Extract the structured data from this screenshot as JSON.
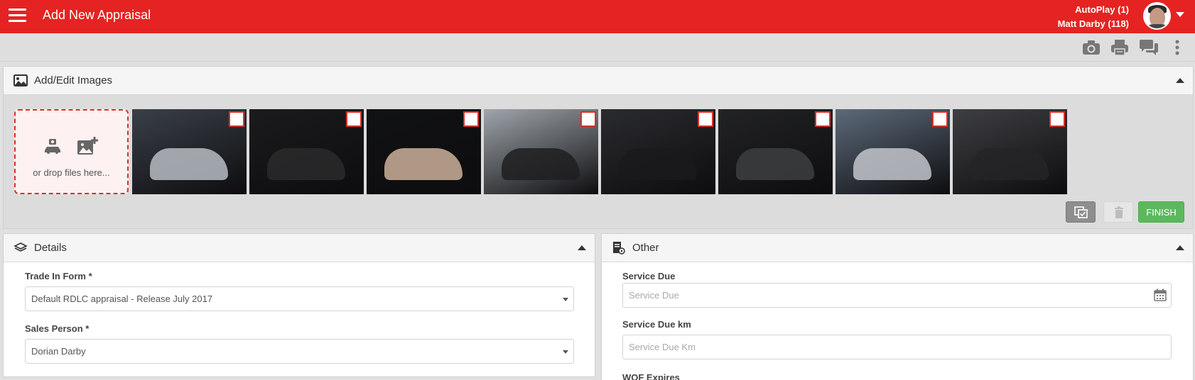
{
  "header": {
    "title": "Add New Appraisal",
    "dealer": "AutoPlay (1)",
    "user": "Matt Darby (118)"
  },
  "toolbar": {
    "icons": [
      "camera-icon",
      "print-icon",
      "chat-icon",
      "more-vertical-icon"
    ]
  },
  "images_panel": {
    "title": "Add/Edit Images",
    "dropzone_text": "or drop files here...",
    "finish_label": "FINISH",
    "thumbnails": [
      {
        "name": "car-exterior-front",
        "bg": "#3a4048",
        "car": "#b7bcc3"
      },
      {
        "name": "gear-shifter",
        "bg": "#1b1b1d",
        "car": "#2a2a2c"
      },
      {
        "name": "steering-wheel-paddles",
        "bg": "#111214",
        "car": "#cbb09a"
      },
      {
        "name": "dashboard-cockpit",
        "bg": "#9fa5ab",
        "car": "#1f1f21"
      },
      {
        "name": "front-seats",
        "bg": "#2a2b2e",
        "car": "#1a1a1c"
      },
      {
        "name": "centre-console",
        "bg": "#222325",
        "car": "#3c3e41"
      },
      {
        "name": "car-exterior-rear",
        "bg": "#5d6a7a",
        "car": "#c2c6cb"
      },
      {
        "name": "rear-seats",
        "bg": "#3e3f42",
        "car": "#242527"
      }
    ]
  },
  "details_panel": {
    "title": "Details",
    "trade_in_label": "Trade In Form *",
    "trade_in_value": "Default RDLC appraisal - Release July 2017",
    "sales_person_label": "Sales Person *",
    "sales_person_value": "Dorian Darby"
  },
  "other_panel": {
    "title": "Other",
    "service_due_label": "Service Due",
    "service_due_placeholder": "Service Due",
    "service_due_km_label": "Service Due km",
    "service_due_km_placeholder": "Service Due Km",
    "wof_expires_label": "WOF Expires"
  },
  "colors": {
    "brand": "#e52322",
    "finish": "#5cb85c",
    "dropzone_border": "#d9302c"
  }
}
